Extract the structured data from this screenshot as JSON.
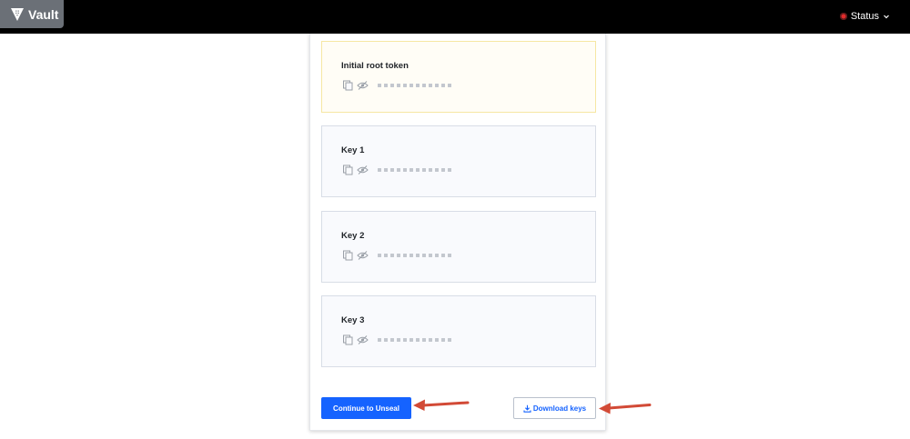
{
  "header": {
    "brand": "Vault",
    "brand_icon": "vault-logo-icon",
    "status_label": "Status",
    "status_icon": "status-dot-icon",
    "status_chevron_icon": "chevron-down-icon"
  },
  "keys": [
    {
      "title": "Initial root token",
      "masked": "●●●●●●●●●●●●",
      "copy_icon": "copy-icon",
      "reveal_icon": "eye-icon"
    },
    {
      "title": "Key 1",
      "masked": "●●●●●●●●●●●●",
      "copy_icon": "copy-icon",
      "reveal_icon": "eye-icon"
    },
    {
      "title": "Key 2",
      "masked": "●●●●●●●●●●●●",
      "copy_icon": "copy-icon",
      "reveal_icon": "eye-icon"
    },
    {
      "title": "Key 3",
      "masked": "●●●●●●●●●●●●",
      "copy_icon": "copy-icon",
      "reveal_icon": "eye-icon"
    }
  ],
  "actions": {
    "continue_label": "Continue to Unseal",
    "download_label": "Download keys",
    "download_icon": "download-icon"
  },
  "colors": {
    "topbar": "#000000",
    "brand_bg": "#6b7077",
    "primary": "#1563ff",
    "status_sealed": "#e02b2b",
    "annotation_arrow": "#d24a36",
    "root_box_border": "#f6e7a3",
    "key_box_border": "#d8dde6"
  }
}
